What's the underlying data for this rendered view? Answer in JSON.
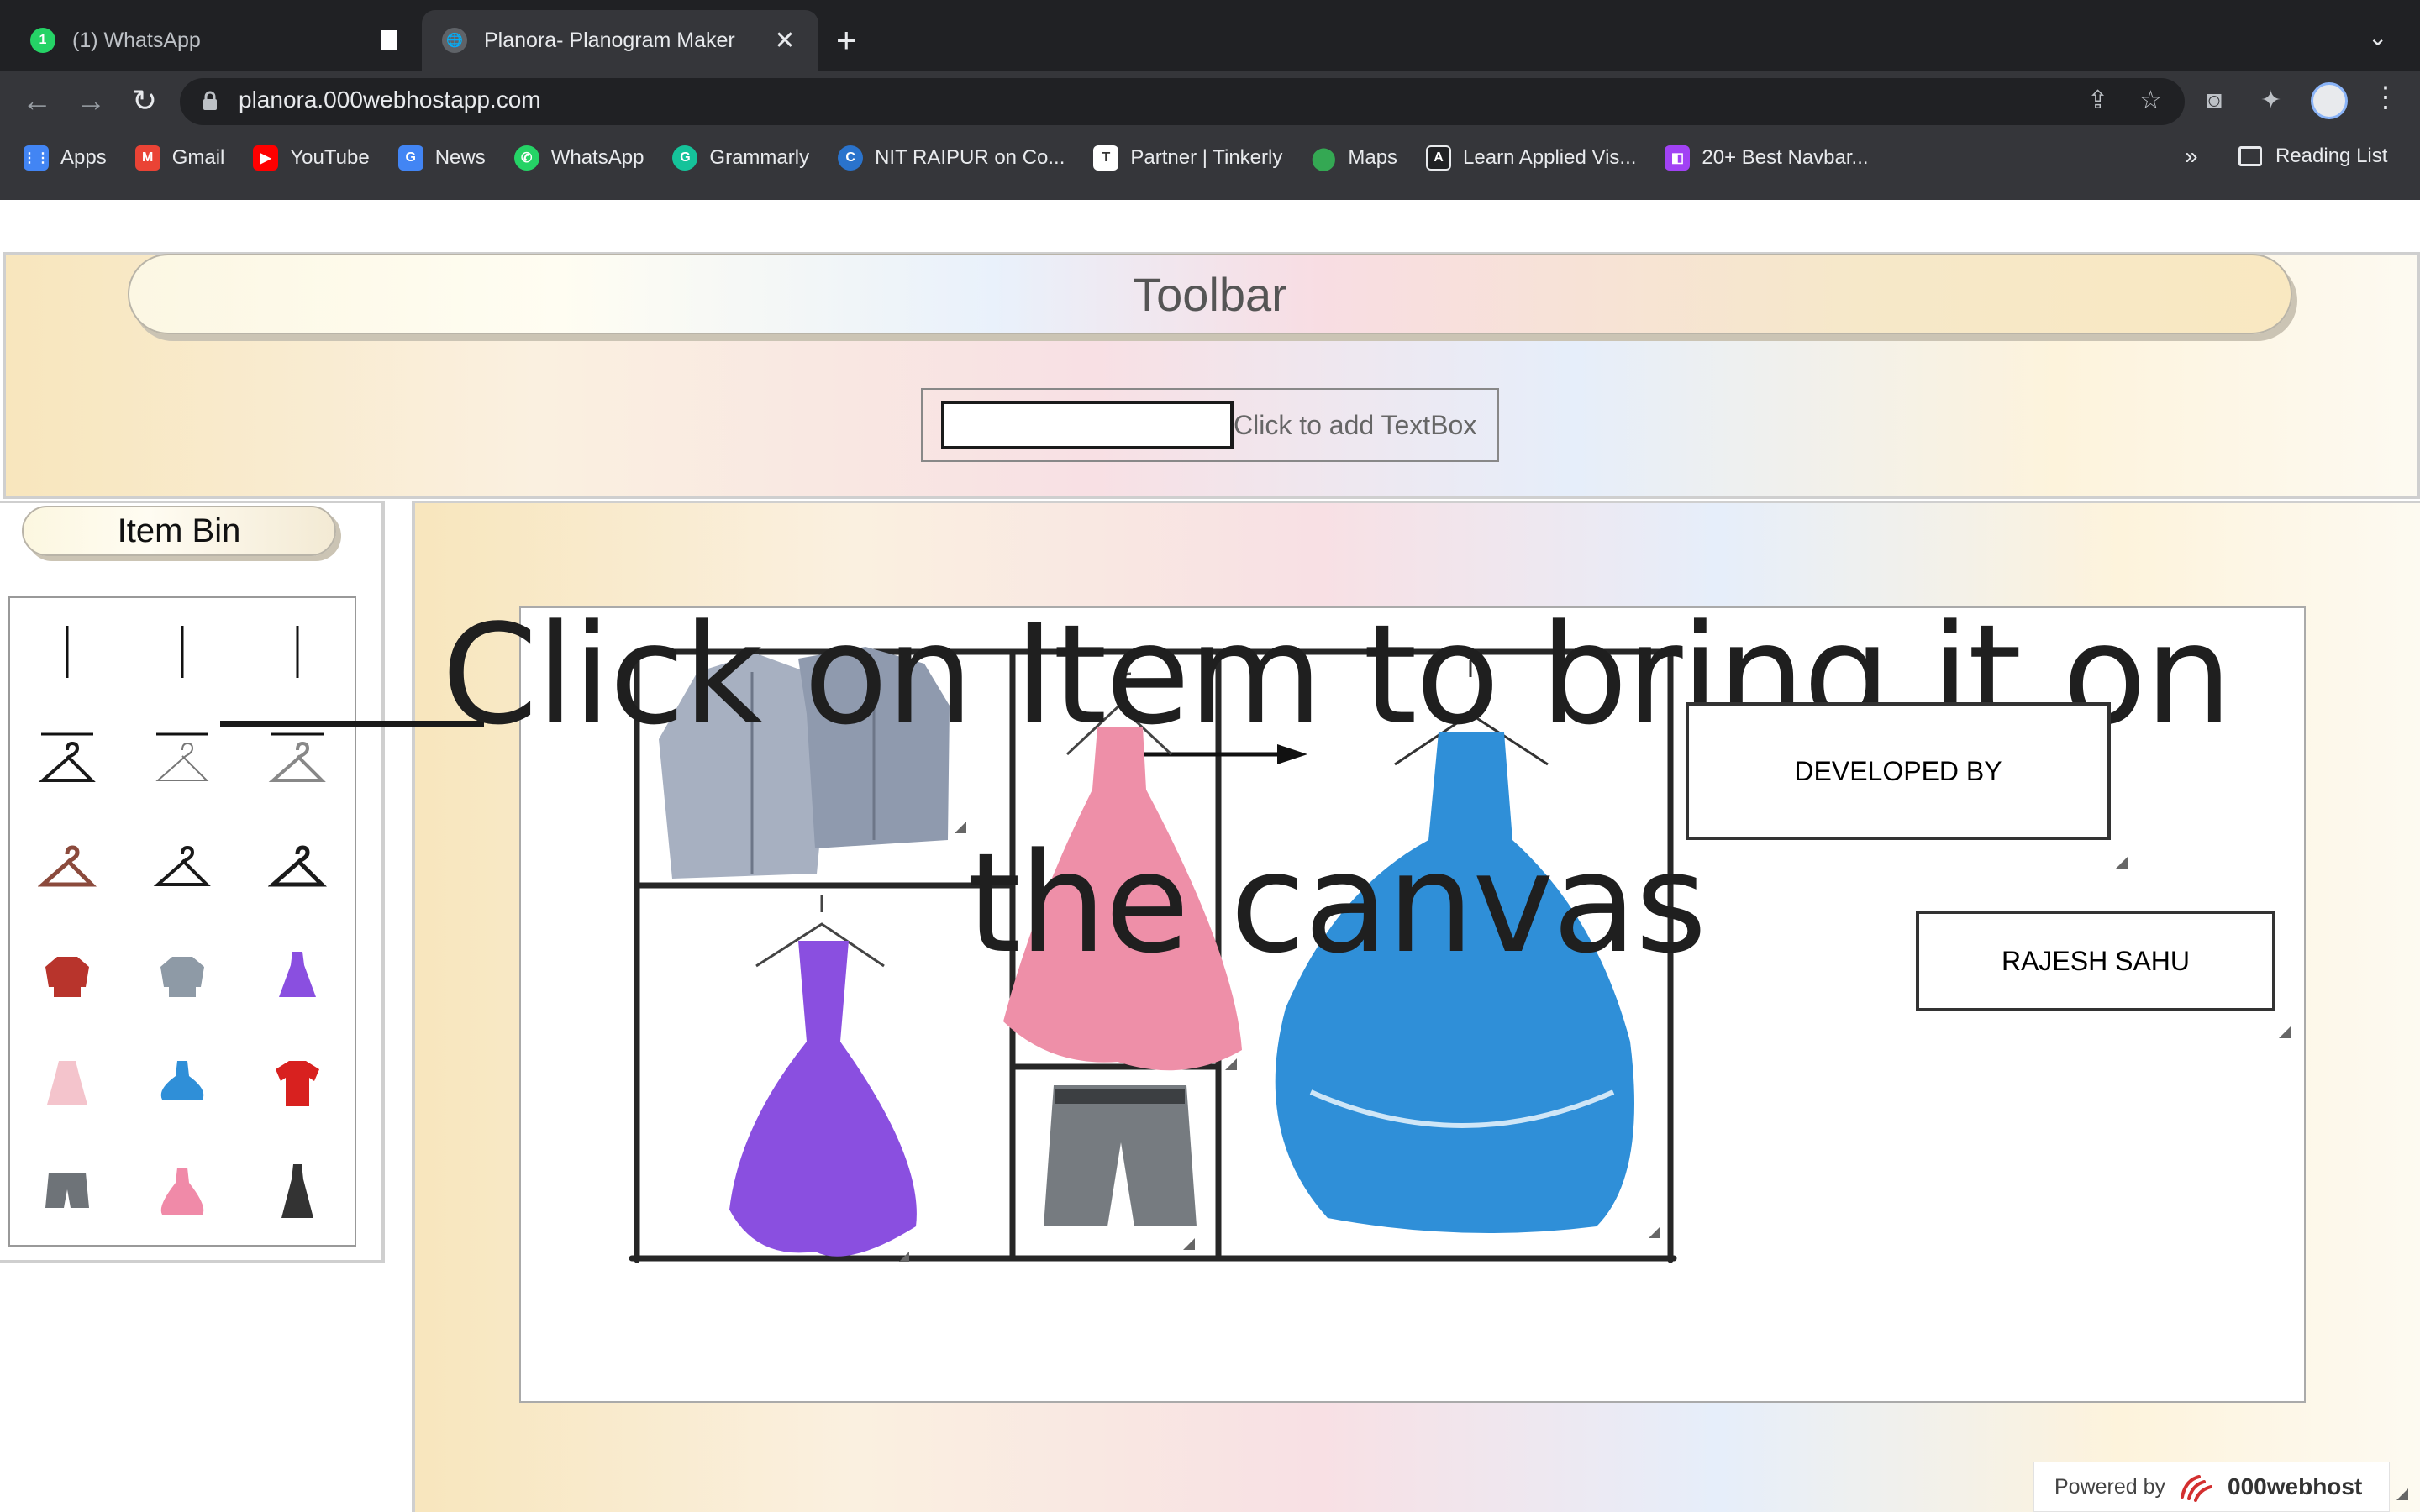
{
  "browser": {
    "tabs": [
      {
        "label": "(1) WhatsApp",
        "badge": "1",
        "active": false
      },
      {
        "label": "Planora- Planogram Maker",
        "active": true
      }
    ],
    "url": "planora.000webhostapp.com",
    "bookmarks": [
      {
        "label": "Apps",
        "icon": "apps-grid-icon",
        "color": "#4285f4"
      },
      {
        "label": "Gmail",
        "icon": "gmail-icon",
        "color": "#ea4335"
      },
      {
        "label": "YouTube",
        "icon": "youtube-icon",
        "color": "#ff0000"
      },
      {
        "label": "News",
        "icon": "google-news-icon",
        "color": "#4285f4"
      },
      {
        "label": "WhatsApp",
        "icon": "whatsapp-icon",
        "color": "#25d366"
      },
      {
        "label": "Grammarly",
        "icon": "grammarly-icon",
        "color": "#15c39a"
      },
      {
        "label": "NIT RAIPUR on Co...",
        "icon": "coursera-icon",
        "color": "#2a73cc"
      },
      {
        "label": "Partner | Tinkerly",
        "icon": "tinkerly-icon",
        "color": "#ffffff"
      },
      {
        "label": "Maps",
        "icon": "maps-pin-icon",
        "color": "#34a853"
      },
      {
        "label": "Learn Applied Vis...",
        "icon": "applied-ai-icon",
        "color": "#202124"
      },
      {
        "label": "20+ Best Navbar...",
        "icon": "navbar-site-icon",
        "color": "#a142f4"
      }
    ],
    "bookmark_overflow": "»",
    "reading_list": "Reading List"
  },
  "page": {
    "toolbar_title": "Toolbar",
    "textbox_value": "",
    "add_textbox_label": "Click to add TextBox",
    "item_bin_title": "Item Bin",
    "item_bin_items": [
      {
        "name": "vertical-rod",
        "icon": "vertical-rod-icon"
      },
      {
        "name": "vertical-rod",
        "icon": "vertical-rod-icon"
      },
      {
        "name": "vertical-rod",
        "icon": "vertical-rod-icon"
      },
      {
        "name": "horizontal-rod",
        "icon": "horizontal-rod-icon"
      },
      {
        "name": "horizontal-rod",
        "icon": "horizontal-rod-icon"
      },
      {
        "name": "horizontal-rod",
        "icon": "horizontal-rod-icon"
      },
      {
        "name": "black-hanger",
        "icon": "hanger-icon",
        "color": "#1a1a1a"
      },
      {
        "name": "wire-hanger",
        "icon": "hanger-icon",
        "color": "#777777"
      },
      {
        "name": "grey-hanger",
        "icon": "hanger-icon",
        "color": "#888888"
      },
      {
        "name": "wooden-hanger",
        "icon": "hanger-icon",
        "color": "#8b4a3c"
      },
      {
        "name": "black-hanger-2",
        "icon": "hanger-icon",
        "color": "#1a1a1a"
      },
      {
        "name": "black-hanger-3",
        "icon": "hanger-icon",
        "color": "#1a1a1a"
      },
      {
        "name": "red-sweater",
        "icon": "sweater-icon",
        "color": "#b8342c"
      },
      {
        "name": "grey-sweater",
        "icon": "sweater-icon",
        "color": "#8e9aa6"
      },
      {
        "name": "purple-dress",
        "icon": "dress-icon",
        "color": "#8a4fe0"
      },
      {
        "name": "pink-kids-dress",
        "icon": "dress-icon",
        "color": "#f4c4cc"
      },
      {
        "name": "blue-tutu-dress",
        "icon": "dress-icon",
        "color": "#2f8fd8"
      },
      {
        "name": "red-tshirt",
        "icon": "tshirt-icon",
        "color": "#d8211f"
      },
      {
        "name": "grey-shorts",
        "icon": "shorts-icon",
        "color": "#6e7378"
      },
      {
        "name": "pink-gown",
        "icon": "dress-icon",
        "color": "#f08aa8"
      },
      {
        "name": "black-dress",
        "icon": "dress-icon",
        "color": "#333333"
      }
    ],
    "instruction": "Click on Item to bring it on the canvas",
    "canvas_items": [
      {
        "name": "grey-shirts",
        "color": "#8f9aae"
      },
      {
        "name": "pink-gown",
        "color": "#ee8fa8"
      },
      {
        "name": "blue-ball-gown",
        "color": "#2f8fd8"
      },
      {
        "name": "purple-dress",
        "color": "#8a4fe0"
      },
      {
        "name": "grey-shorts",
        "color": "#767b80"
      }
    ],
    "developed_by_label": "DEVELOPED BY",
    "developer_name": "RAJESH SAHU",
    "powered_by": "Powered by",
    "host_brand": "000webhost"
  },
  "colors": {
    "chrome_dark": "#202124",
    "chrome_mid": "#35363a",
    "pastel_yellow": "#f8e6bd",
    "pastel_pink": "#f8e0e4",
    "pastel_blue": "#e6eefa"
  }
}
